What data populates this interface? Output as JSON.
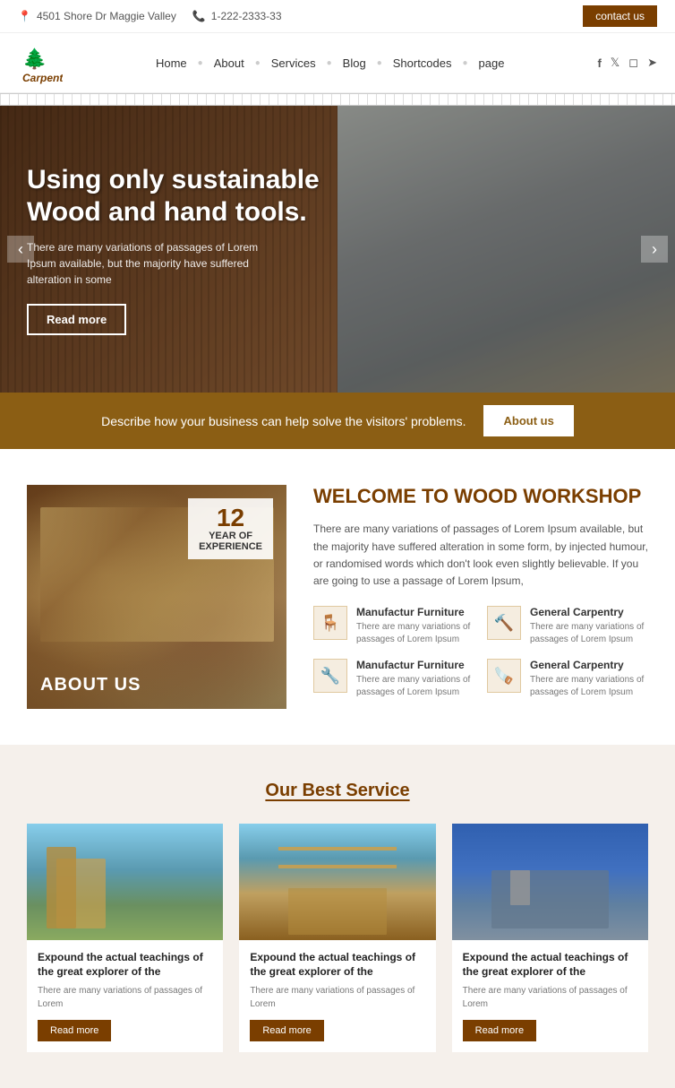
{
  "topbar": {
    "address": "4501 Shore Dr Maggie Valley",
    "phone": "1-222-2333-33",
    "contact_btn": "contact us"
  },
  "nav": {
    "logo_text": "Carpentry",
    "links": [
      "Home",
      "About",
      "Services",
      "Blog",
      "Shortcodes",
      "page"
    ]
  },
  "hero": {
    "title": "Using only sustainable Wood and hand tools.",
    "subtitle": "There are many variations of passages of Lorem Ipsum available, but the majority have suffered alteration in some",
    "read_more": "Read more",
    "prev_label": "‹",
    "next_label": "›",
    "bottom_text": "Describe how your business can help solve the visitors' problems.",
    "about_us_btn": "About us"
  },
  "about": {
    "badge_number": "12",
    "badge_line1": "YEAR OF",
    "badge_line2": "EXPERIENCE",
    "image_label_normal": "ABOUT ",
    "image_label_bold": "US",
    "title": "WELCOME TO WOOD WORKSHOP",
    "description": "There are many variations of passages of Lorem Ipsum available, but the majority have suffered alteration in some form, by injected humour, or randomised words which don't look even slightly believable. If you are going to use a passage of Lorem Ipsum,",
    "features": [
      {
        "icon": "🪑",
        "title": "Manufactur Furniture",
        "desc": "There are many variations of passages of Lorem Ipsum"
      },
      {
        "icon": "🔨",
        "title": "General Carpentry",
        "desc": "There are many variations of passages of Lorem Ipsum"
      },
      {
        "icon": "🔧",
        "title": "Manufactur Furniture",
        "desc": "There are many variations of passages of Lorem Ipsum"
      },
      {
        "icon": "🪚",
        "title": "General Carpentry",
        "desc": "There are many variations of passages of Lorem Ipsum"
      }
    ]
  },
  "services": {
    "title": "Our Best Service",
    "cards": [
      {
        "title": "Expound the actual teachings of the great explorer of the",
        "desc": "There are many variations of passages of Lorem",
        "read_more": "Read more"
      },
      {
        "title": "Expound the actual teachings of the great explorer of the",
        "desc": "There are many variations of passages of Lorem",
        "read_more": "Read more"
      },
      {
        "title": "Expound the actual teachings of the great explorer of the",
        "desc": "There are many variations of passages of Lorem",
        "read_more": "Read more"
      }
    ]
  }
}
